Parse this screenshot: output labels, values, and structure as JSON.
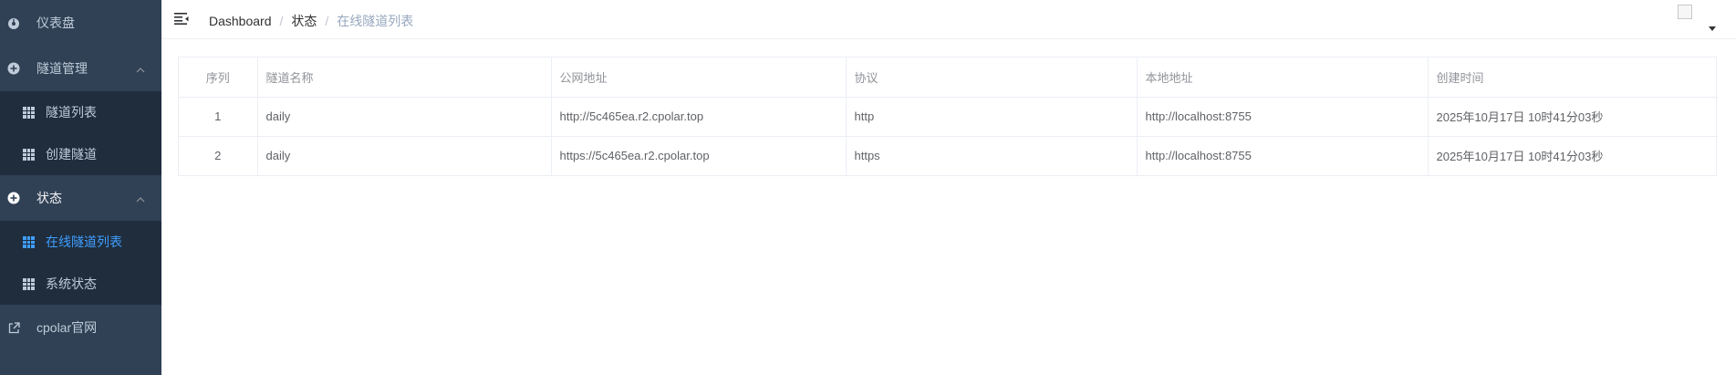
{
  "sidebar": {
    "items": [
      {
        "label": "仪表盘",
        "icon": "dashboard-icon"
      },
      {
        "label": "隧道管理",
        "icon": "plus-circle-icon",
        "children": [
          {
            "label": "隧道列表",
            "icon": "grid-icon"
          },
          {
            "label": "创建隧道",
            "icon": "grid-icon"
          }
        ]
      },
      {
        "label": "状态",
        "icon": "plus-circle-icon",
        "children": [
          {
            "label": "在线隧道列表",
            "icon": "grid-icon",
            "active": true
          },
          {
            "label": "系统状态",
            "icon": "grid-icon"
          }
        ]
      },
      {
        "label": "cpolar官网",
        "icon": "external-link-icon"
      }
    ]
  },
  "header": {
    "breadcrumb": [
      "Dashboard",
      "状态",
      "在线隧道列表"
    ]
  },
  "table": {
    "columns": [
      "序列",
      "隧道名称",
      "公网地址",
      "协议",
      "本地地址",
      "创建时间"
    ],
    "rows": [
      [
        "1",
        "daily",
        "http://5c465ea.r2.cpolar.top",
        "http",
        "http://localhost:8755",
        "2025年10月17日 10时41分03秒"
      ],
      [
        "2",
        "daily",
        "https://5c465ea.r2.cpolar.top",
        "https",
        "http://localhost:8755",
        "2025年10月17日 10时41分03秒"
      ]
    ]
  },
  "colors": {
    "sidebar_bg": "#304156",
    "submenu_bg": "#1f2d3d",
    "sidebar_text": "#bfcbd9",
    "active": "#409eff"
  }
}
